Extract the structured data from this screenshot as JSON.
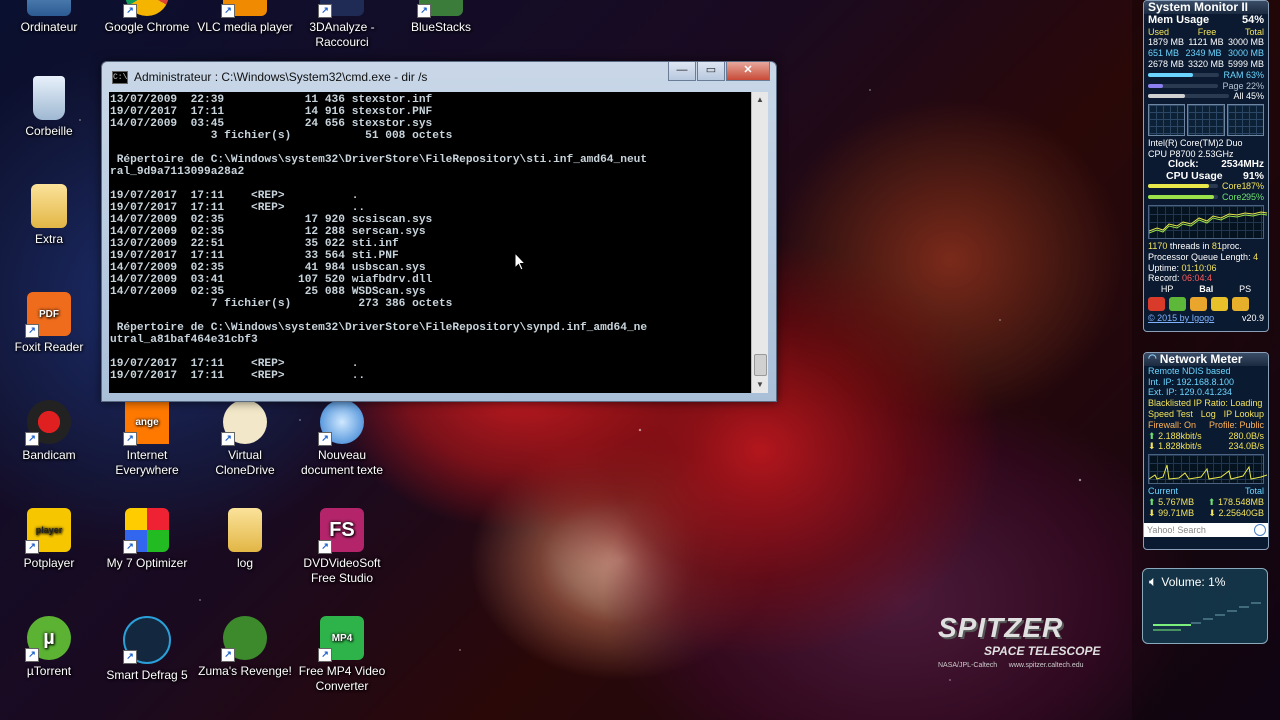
{
  "desktop_icons": [
    {
      "label": "Ordinateur",
      "icon": "computer-icon"
    },
    {
      "label": "Google Chrome",
      "icon": "chrome-icon"
    },
    {
      "label": "VLC media player",
      "icon": "vlc-icon"
    },
    {
      "label": "3DAnalyze - Raccourci",
      "icon": "3danalyze-icon"
    },
    {
      "label": "BlueStacks",
      "icon": "bluestacks-icon"
    },
    {
      "label": "Corbeille",
      "icon": "recycle-bin-icon"
    },
    {
      "label": "Extra",
      "icon": "folder-icon"
    },
    {
      "label": "Foxit Reader",
      "icon": "foxit-icon"
    },
    {
      "label": "Bandicam",
      "icon": "bandicam-icon"
    },
    {
      "label": "Internet Everywhere",
      "icon": "orange-icon"
    },
    {
      "label": "Virtual CloneDrive",
      "icon": "clonedrive-icon"
    },
    {
      "label": "Nouveau document texte",
      "icon": "document-icon"
    },
    {
      "label": "Potplayer",
      "icon": "potplayer-icon"
    },
    {
      "label": "My 7 Optimizer",
      "icon": "optimizer-icon"
    },
    {
      "label": "log",
      "icon": "folder-icon"
    },
    {
      "label": "DVDVideoSoft Free Studio",
      "icon": "dvdvideosoft-icon"
    },
    {
      "label": "µTorrent",
      "icon": "utorrent-icon"
    },
    {
      "label": "Smart Defrag 5",
      "icon": "smartdefrag-icon"
    },
    {
      "label": "Zuma's Revenge!",
      "icon": "zuma-icon"
    },
    {
      "label": "Free MP4 Video Converter",
      "icon": "mp4-icon"
    }
  ],
  "cmd": {
    "title": "Administrateur : C:\\Windows\\System32\\cmd.exe - dir  /s",
    "lines": [
      "13/07/2009  22:39            11 436 stexstor.inf",
      "19/07/2017  17:11            14 916 stexstor.PNF",
      "14/07/2009  03:45            24 656 stexstor.sys",
      "               3 fichier(s)           51 008 octets",
      "",
      " Répertoire de C:\\Windows\\system32\\DriverStore\\FileRepository\\sti.inf_amd64_neut",
      "ral_9d9a7113099a28a2",
      "",
      "19/07/2017  17:11    <REP>          .",
      "19/07/2017  17:11    <REP>          ..",
      "14/07/2009  02:35            17 920 scsiscan.sys",
      "14/07/2009  02:35            12 288 serscan.sys",
      "13/07/2009  22:51            35 022 sti.inf",
      "19/07/2017  17:11            33 564 sti.PNF",
      "14/07/2009  02:35            41 984 usbscan.sys",
      "14/07/2009  03:41           107 520 wiafbdrv.dll",
      "14/07/2009  02:35            25 088 WSDScan.sys",
      "               7 fichier(s)          273 386 octets",
      "",
      " Répertoire de C:\\Windows\\system32\\DriverStore\\FileRepository\\synpd.inf_amd64_ne",
      "utral_a81baf464e31cbf3",
      "",
      "19/07/2017  17:11    <REP>          .",
      "19/07/2017  17:11    <REP>          .."
    ]
  },
  "system_monitor": {
    "title": "System Monitor II",
    "mem_label": "Mem Usage",
    "mem_percent": "54%",
    "mem_cols": [
      "Used",
      "Free",
      "Total"
    ],
    "mem_rows": [
      [
        "1879 MB",
        "1121 MB",
        "3000 MB"
      ],
      [
        "651 MB",
        "2349 MB",
        "3000 MB"
      ],
      [
        "2678 MB",
        "3320 MB",
        "5999 MB"
      ]
    ],
    "ram": "RAM  63%",
    "page": "Page  22%",
    "all": "All  45%",
    "ram_fill": 0.63,
    "page_fill": 0.22,
    "all_fill": 0.45,
    "cpu_name": "Intel(R) Core(TM)2 Duo",
    "cpu_model": "CPU   P8700  2.53GHz",
    "clock_label": "Clock:",
    "clock_value": "2534MHz",
    "cpu_label": "CPU Usage",
    "cpu_percent": "91%",
    "core1": "Core1",
    "core1_val": "87%",
    "core2": "Core2",
    "core2_val": "95%",
    "core1_fill": 0.87,
    "core2_fill": 0.95,
    "threads_a": "1170",
    "threads_text": " threads in ",
    "threads_b": "81",
    "threads_c": " proc.",
    "queue": "Processor Queue Length: ",
    "queue_val": "4",
    "uptime": "Uptime: ",
    "uptime_val": "01:10:06",
    "record": "Record: ",
    "record_val": "06:04:4",
    "modes": [
      "HP",
      "Bal",
      "PS"
    ],
    "footer": "© 2015 by Igogo",
    "version": "v20.9"
  },
  "network_meter": {
    "title": "Network Meter",
    "remote": "Remote NDIS based",
    "int_ip": "Int. IP: 192.168.8.100",
    "ext_ip": "Ext. IP: 129.0.41.234",
    "blacklist": "Blacklisted IP Ratio: Loading",
    "speed_test": "Speed Test",
    "log": "Log",
    "ip_lookup": "IP Lookup",
    "firewall": "Firewall: On",
    "profile": "Profile: Public",
    "up_rate": "2.188kbit/s",
    "up_bytes": "280.0B/s",
    "down_rate": "1.828kbit/s",
    "down_bytes": "234.0B/s",
    "current": "Current",
    "total": "Total",
    "cur_up": "5.767MB",
    "tot_up": "178.548MB",
    "cur_down": "99.71MB",
    "tot_down": "2.25640GB",
    "search_placeholder": "Yahoo! Search"
  },
  "volume": {
    "label": "Volume: 1%"
  },
  "spitzer": {
    "big": "SPITZER",
    "sub": "SPACE TELESCOPE",
    "credit": "NASA/JPL-Caltech      www.spitzer.caltech.edu"
  }
}
